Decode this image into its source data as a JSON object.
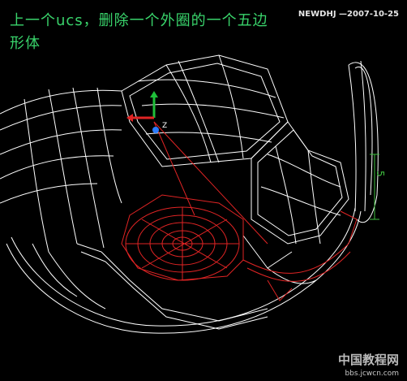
{
  "viewport": {
    "instruction": "上一个ucs，删除一个外圈的一个五边形体",
    "author_stamp": "NEWDHJ —2007-10-25",
    "dimension_label": "5",
    "colors": {
      "background": "#000000",
      "wire": "#ffffff",
      "highlight": "#e02424",
      "instruction_text": "#39d36b",
      "dimension": "#3fbf3f"
    },
    "ucs_icon": {
      "axes": [
        "x-axis",
        "y-axis",
        "z-axis"
      ],
      "colors": {
        "x": "#e02424",
        "y": "#1fbf3a",
        "z": "#2a7bff"
      }
    }
  },
  "watermark": {
    "text": "中国教程网",
    "url": "bbs.jcwcn.com"
  }
}
